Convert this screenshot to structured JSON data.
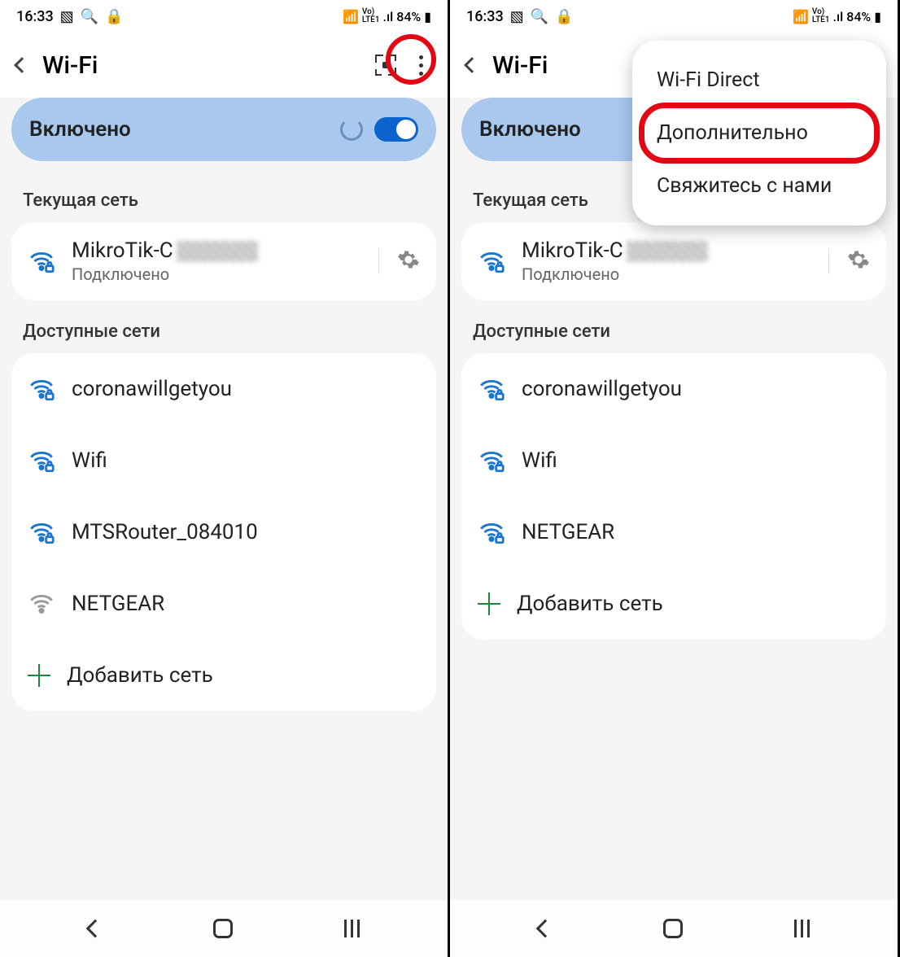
{
  "status": {
    "time": "16:33",
    "battery": "84%"
  },
  "header": {
    "title": "Wi-Fi"
  },
  "toggle": {
    "label": "Включено"
  },
  "sections": {
    "current_label": "Текущая сеть",
    "available_label": "Доступные сети"
  },
  "current_network": {
    "name_prefix": "MikroTik-C",
    "status": "Подключено"
  },
  "popup": {
    "item1": "Wi-Fi Direct",
    "item2": "Дополнительно",
    "item3": "Свяжитесь с нами"
  },
  "add_network_label": "Добавить сеть",
  "left_networks": [
    {
      "name": "coronawillgetyou",
      "secure": true,
      "strong": true
    },
    {
      "name": "Wifi",
      "secure": true,
      "strong": true
    },
    {
      "name": "MTSRouter_084010",
      "secure": true,
      "strong": true
    },
    {
      "name": "NETGEAR",
      "secure": false,
      "strong": false
    }
  ],
  "right_networks": [
    {
      "name": "coronawillgetyou",
      "secure": true,
      "strong": true
    },
    {
      "name": "Wifi",
      "secure": true,
      "strong": true
    },
    {
      "name": "NETGEAR",
      "secure": true,
      "strong": true
    }
  ]
}
